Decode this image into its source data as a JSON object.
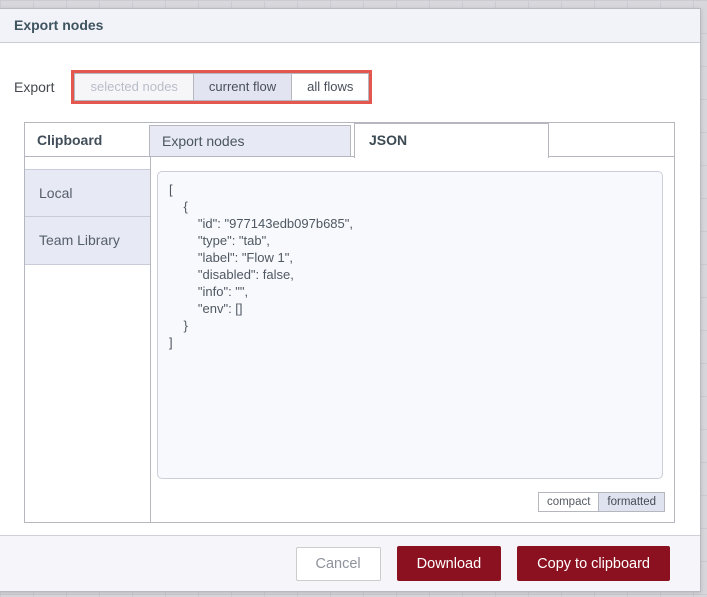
{
  "dialog": {
    "title": "Export nodes",
    "export_label": "Export",
    "scope_options": [
      {
        "label": "selected nodes",
        "state": "disabled"
      },
      {
        "label": "current flow",
        "state": "selected"
      },
      {
        "label": "all flows",
        "state": "normal"
      }
    ],
    "library": {
      "clipboard_label": "Clipboard",
      "tabs": [
        {
          "label": "Export nodes",
          "active": false
        },
        {
          "label": "JSON",
          "active": true
        }
      ],
      "sidebar_items": [
        {
          "label": "Local"
        },
        {
          "label": "Team Library"
        }
      ],
      "editor_content": "[\n    {\n        \"id\": \"977143edb097b685\",\n        \"type\": \"tab\",\n        \"label\": \"Flow 1\",\n        \"disabled\": false,\n        \"info\": \"\",\n        \"env\": []\n    }\n]",
      "format_toggle": [
        {
          "label": "compact",
          "selected": false
        },
        {
          "label": "formatted",
          "selected": true
        }
      ]
    },
    "footer": {
      "cancel_label": "Cancel",
      "download_label": "Download",
      "copy_label": "Copy to clipboard"
    },
    "colors": {
      "primary_button": "#8C1120",
      "annotation_outline": "#E4574F",
      "selected_tab_bg": "#E7E9F4",
      "header_bg": "#F2F3F9"
    }
  }
}
